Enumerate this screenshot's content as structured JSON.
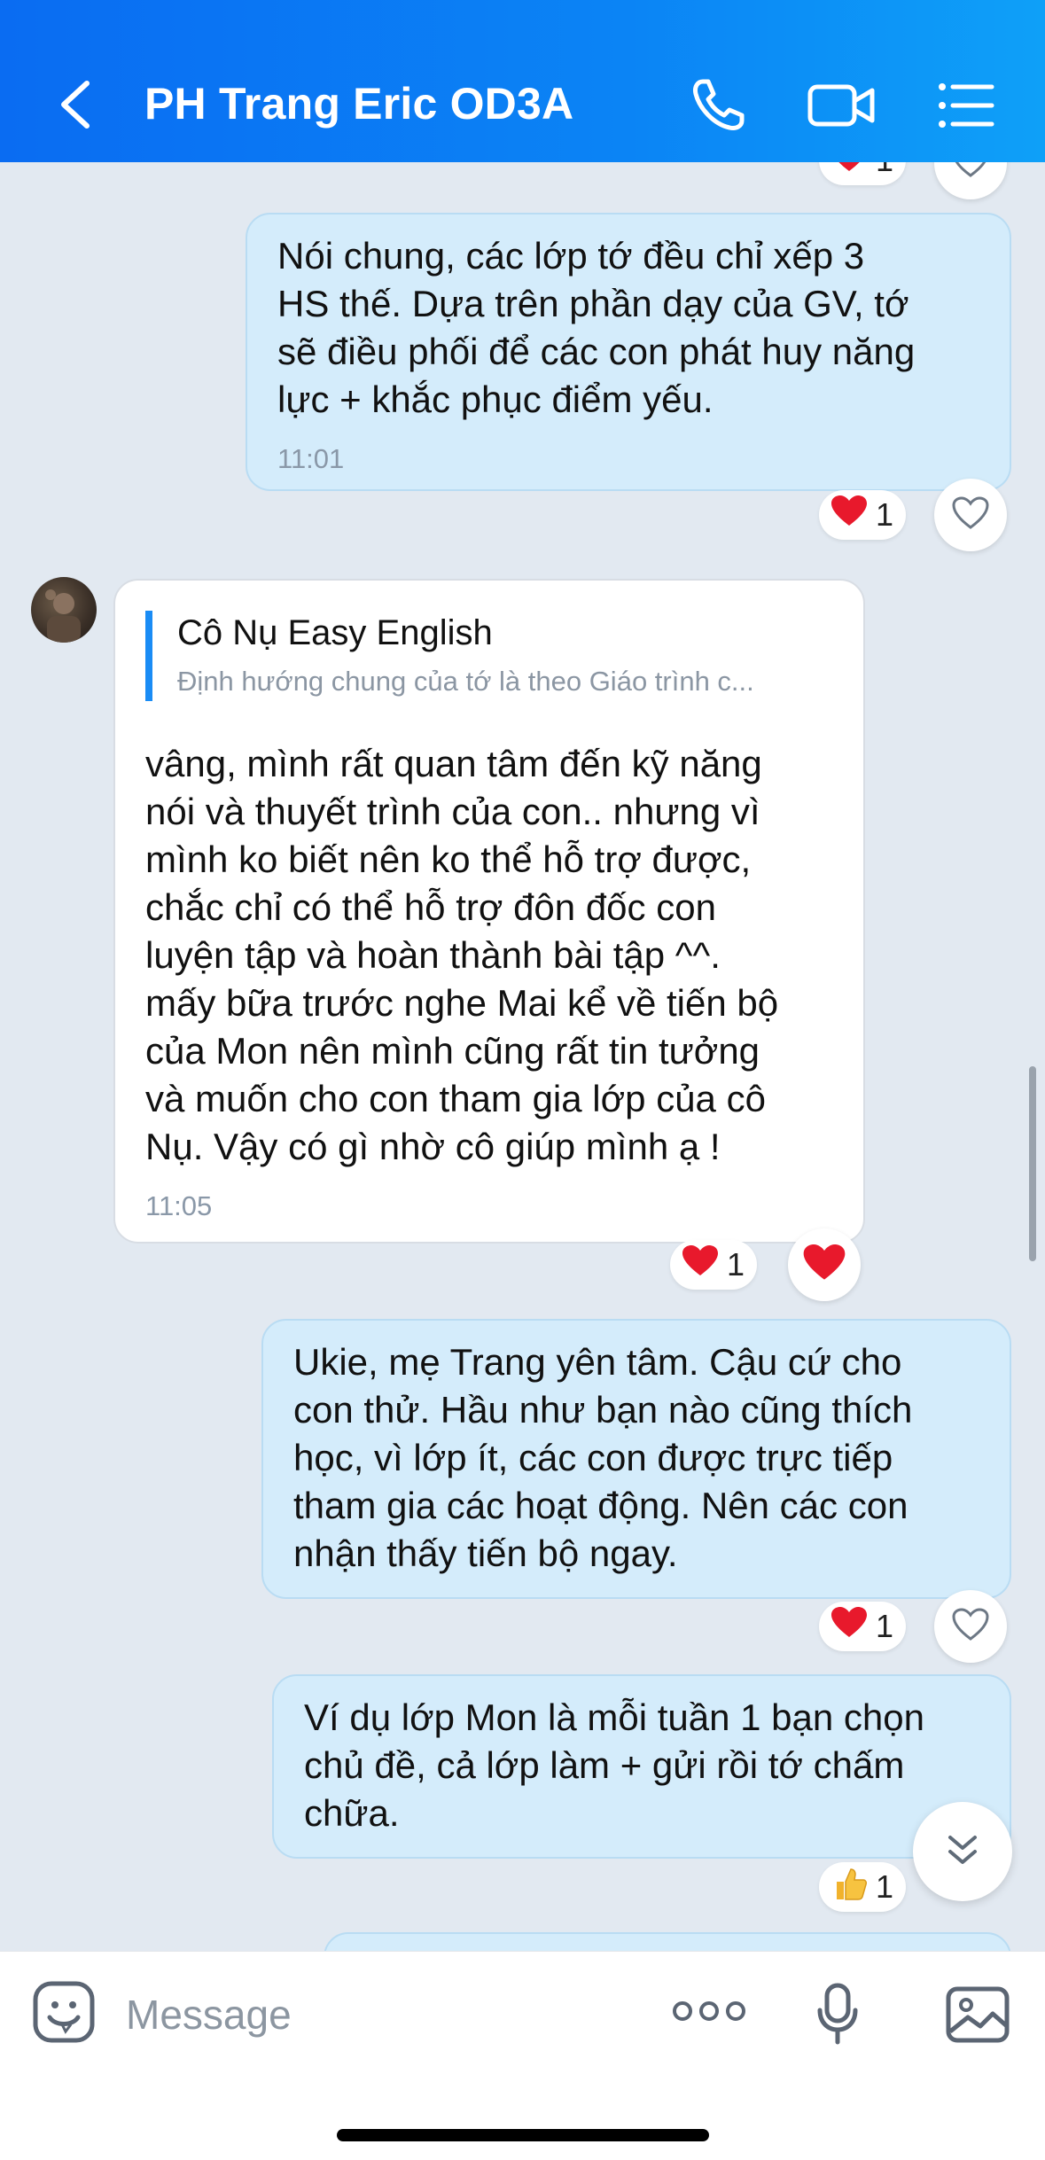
{
  "header": {
    "title": "PH Trang Eric OD3A"
  },
  "messages": [
    {
      "text": "Nói chung, các lớp tớ đều chỉ xếp 3\nHS thế. Dựa trên phần dạy của GV, tớ\nsẽ điều phối để các con phát huy năng\nlực + khắc phục điểm yếu.",
      "time": "11:01",
      "reaction_count": "1"
    },
    {
      "quote_name": "Cô Nụ Easy English",
      "quote_text": "Định hướng chung của tớ là theo Giáo trình c...",
      "text": "vâng, mình rất quan tâm đến kỹ năng\nnói và thuyết trình của con.. nhưng vì\nmình ko biết nên ko thể hỗ trợ được,\nchắc chỉ có thể hỗ trợ đôn đốc con\nluyện tập và hoàn thành bài tập ^^.\nmấy bữa trước nghe Mai kể về tiến bộ\ncủa Mon nên mình cũng rất tin tưởng\nvà muốn cho con tham gia lớp của cô\nNụ. Vậy có gì nhờ cô giúp mình ạ !",
      "time": "11:05",
      "reaction_count": "1"
    },
    {
      "text": "Ukie, mẹ Trang yên tâm. Cậu cứ cho\ncon thử. Hầu như bạn nào cũng thích\nhọc, vì lớp ít, các con được trực tiếp\ntham gia các hoạt động. Nên các con\nnhận thấy tiến bộ ngay.",
      "reaction_count": "1"
    },
    {
      "text": "Ví dụ lớp Mon là mỗi tuần 1 bạn chọn\nchủ đề, cả lớp làm + gửi rồi tớ chấm\nchữa.",
      "reaction_count": "1"
    }
  ],
  "top_reaction_count": "1",
  "input": {
    "placeholder": "Message"
  },
  "colors": {
    "header": "#0a7cf3",
    "outgoing_bubble": "#d4ecfb",
    "incoming_bubble": "#ffffff",
    "background": "#e2e9f1",
    "heart": "#e8192c"
  }
}
